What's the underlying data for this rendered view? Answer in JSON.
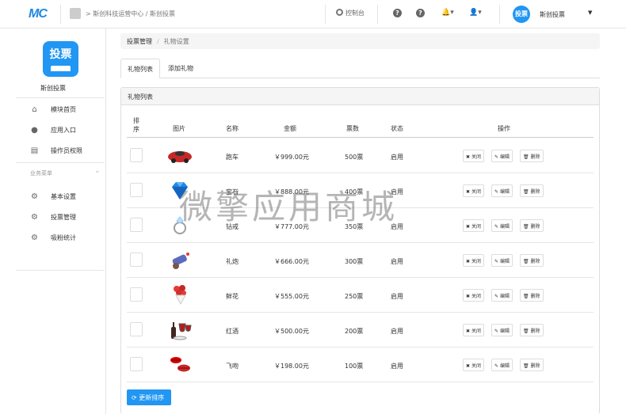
{
  "topbar": {
    "logo": "MC",
    "breadcrumb": "> 斯创科技运营中心 / 斯创投票",
    "console": "控制台",
    "user_name": "斯创投票",
    "avatar_text": "投票"
  },
  "sidebar": {
    "app_logo": "投票",
    "app_name": "斯创投票",
    "items": [
      {
        "label": "模块首页",
        "icon": "home-icon"
      },
      {
        "label": "应用入口",
        "icon": "chat-icon"
      },
      {
        "label": "操作员权限",
        "icon": "user-file-icon"
      }
    ],
    "section_title": "业务菜单",
    "section_items": [
      {
        "label": "基本设置",
        "icon": "gear-icon"
      },
      {
        "label": "投票管理",
        "icon": "gear-icon"
      },
      {
        "label": "吸粉统计",
        "icon": "gear-icon"
      }
    ]
  },
  "breadcrumb": {
    "parent": "投票管理",
    "current": "礼物设置"
  },
  "tabs": [
    {
      "label": "礼物列表"
    },
    {
      "label": "添加礼物"
    }
  ],
  "panel": {
    "title": "礼物列表"
  },
  "table": {
    "headers": {
      "sort": "排序",
      "image": "图片",
      "name": "名称",
      "amount": "金额",
      "votes": "票数",
      "status": "状态",
      "actions": "操作"
    },
    "rows": [
      {
        "name": "跑车",
        "amount": "￥999.00元",
        "votes": "500票",
        "status": "启用",
        "icon": "sports-car-icon"
      },
      {
        "name": "宝石",
        "amount": "￥888.00元",
        "votes": "400票",
        "status": "启用",
        "icon": "gem-icon"
      },
      {
        "name": "钻戒",
        "amount": "￥777.00元",
        "votes": "350票",
        "status": "启用",
        "icon": "ring-icon"
      },
      {
        "name": "礼炮",
        "amount": "￥666.00元",
        "votes": "300票",
        "status": "启用",
        "icon": "cannon-icon"
      },
      {
        "name": "鲜花",
        "amount": "￥555.00元",
        "votes": "250票",
        "status": "启用",
        "icon": "flower-icon"
      },
      {
        "name": "红酒",
        "amount": "￥500.00元",
        "votes": "200票",
        "status": "启用",
        "icon": "wine-icon"
      },
      {
        "name": "飞吻",
        "amount": "￥198.00元",
        "votes": "100票",
        "status": "启用",
        "icon": "kiss-icon"
      }
    ],
    "btn_close": "关闭",
    "btn_edit": "编辑",
    "btn_delete": "删除"
  },
  "update_button": "更新排序",
  "watermark": "微擎应用商城",
  "colors": {
    "primary": "#2196f3",
    "car_red": "#c62828",
    "gem_blue": "#1e88e5"
  }
}
